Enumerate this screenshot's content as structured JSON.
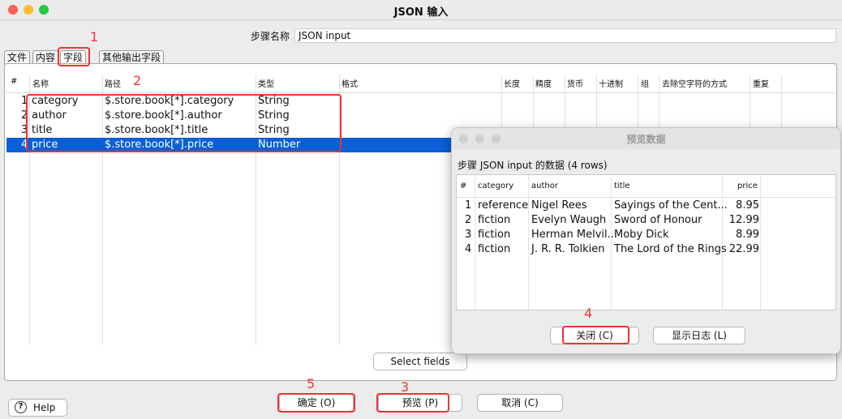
{
  "window": {
    "title": "JSON 输入"
  },
  "step": {
    "label": "步骤名称",
    "value": "JSON input"
  },
  "tabs": [
    "文件",
    "内容",
    "字段",
    "其他输出字段"
  ],
  "grid": {
    "columns": [
      "#",
      "名称",
      "路径",
      "类型",
      "格式",
      "长度",
      "精度",
      "货币",
      "十进制",
      "组",
      "去除空字符的方式",
      "重复"
    ],
    "rows": [
      {
        "num": "1",
        "name": "category",
        "path": "$.store.book[*].category",
        "type": "String"
      },
      {
        "num": "2",
        "name": "author",
        "path": "$.store.book[*].author",
        "type": "String"
      },
      {
        "num": "3",
        "name": "title",
        "path": "$.store.book[*].title",
        "type": "String"
      },
      {
        "num": "4",
        "name": "price",
        "path": "$.store.book[*].price",
        "type": "Number"
      }
    ],
    "selected_row": 4
  },
  "select_fields_label": "Select fields",
  "annotations": [
    "1",
    "2",
    "3",
    "4",
    "5"
  ],
  "buttons": {
    "help": "Help",
    "ok": "确定 (O)",
    "preview": "预览 (P)",
    "cancel": "取消 (C)"
  },
  "preview": {
    "title": "预览数据",
    "subtitle": "步骤 JSON input 的数据  (4 rows)",
    "columns": [
      "#",
      "category",
      "author",
      "title",
      "price"
    ],
    "rows": [
      {
        "num": "1",
        "category": "reference",
        "author": "Nigel Rees",
        "title": "Sayings of the Cent...",
        "price": "8.95"
      },
      {
        "num": "2",
        "category": "fiction",
        "author": "Evelyn Waugh",
        "title": "Sword of Honour",
        "price": "12.99"
      },
      {
        "num": "3",
        "category": "fiction",
        "author": "Herman Melvil...",
        "title": "Moby Dick",
        "price": "8.99"
      },
      {
        "num": "4",
        "category": "fiction",
        "author": "J. R. R. Tolkien",
        "title": "The Lord of the Rings",
        "price": "22.99"
      }
    ],
    "close_label": "关闭 (C)",
    "log_label": "显示日志 (L)"
  },
  "colors": {
    "selection": "#0a5fd6",
    "annotation": "#e33333"
  }
}
